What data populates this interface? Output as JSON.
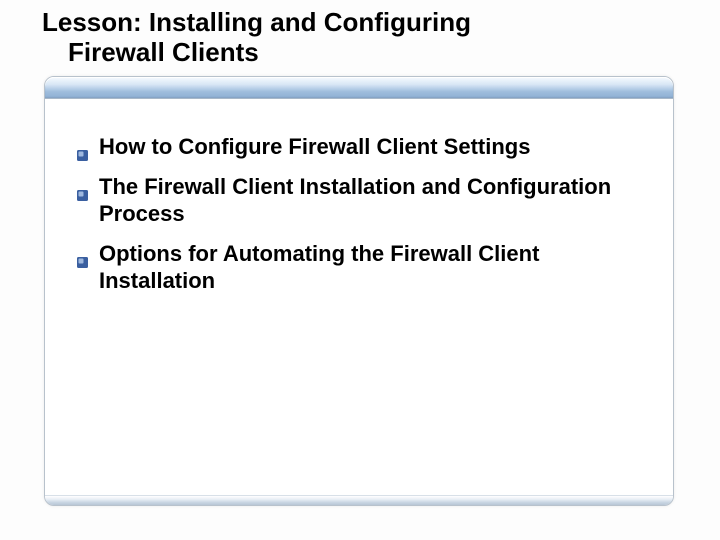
{
  "title": {
    "line1": "Lesson: Installing and Configuring",
    "line2": "Firewall Clients"
  },
  "bullets": [
    "How to Configure Firewall Client Settings",
    "The Firewall Client Installation and Configuration Process",
    "Options for Automating the Firewall Client Installation"
  ],
  "colors": {
    "bullet_fill": "#3a5fa0",
    "bullet_highlight": "#9fb8de"
  }
}
